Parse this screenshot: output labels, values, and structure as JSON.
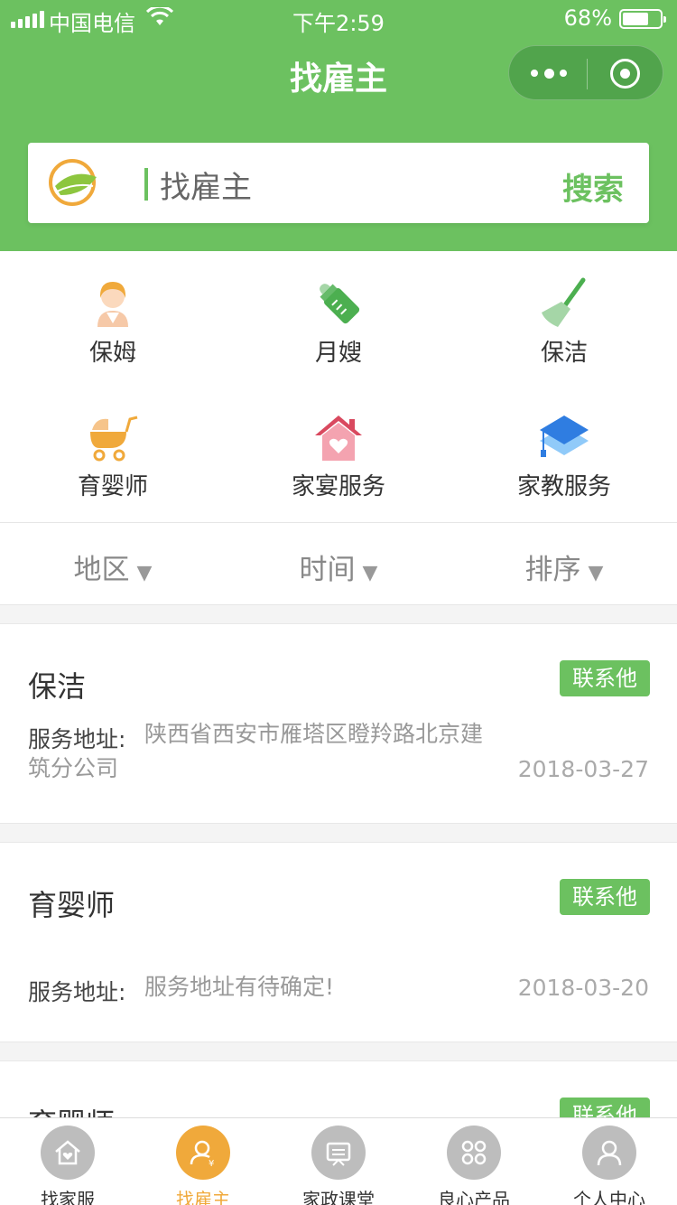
{
  "status_bar": {
    "carrier": "中国电信",
    "time": "下午2:59",
    "battery": "68%"
  },
  "nav": {
    "title": "找雇主"
  },
  "search": {
    "placeholder": "找雇主",
    "button": "搜索"
  },
  "categories": [
    {
      "label": "保姆",
      "icon": "nanny-icon"
    },
    {
      "label": "月嫂",
      "icon": "baby-bottle-icon"
    },
    {
      "label": "保洁",
      "icon": "broom-icon"
    },
    {
      "label": "育婴师",
      "icon": "stroller-icon"
    },
    {
      "label": "家宴服务",
      "icon": "house-heart-icon"
    },
    {
      "label": "家教服务",
      "icon": "graduation-cap-icon"
    }
  ],
  "filters": [
    {
      "label": "地区"
    },
    {
      "label": "时间"
    },
    {
      "label": "排序"
    }
  ],
  "listings": [
    {
      "title": "保洁",
      "contact": "联系他",
      "addr_label": "服务地址:",
      "addr_line1": "陕西省西安市雁塔区瞪羚路北京建",
      "addr_line2": "筑分公司",
      "date": "2018-03-27"
    },
    {
      "title": "育婴师",
      "contact": "联系他",
      "addr_label": "服务地址:",
      "addr_line1": "服务地址有待确定!",
      "date": "2018-03-20"
    },
    {
      "title": "育婴师",
      "contact": "联系他"
    }
  ],
  "tabbar": [
    {
      "label": "找家服",
      "icon": "home-icon",
      "active": false
    },
    {
      "label": "找雇主",
      "icon": "employer-icon",
      "active": true
    },
    {
      "label": "家政课堂",
      "icon": "classroom-icon",
      "active": false
    },
    {
      "label": "良心产品",
      "icon": "products-icon",
      "active": false
    },
    {
      "label": "个人中心",
      "icon": "user-icon",
      "active": false
    }
  ],
  "colors": {
    "brand_green": "#6cc160",
    "active_orange": "#f0a93b"
  }
}
